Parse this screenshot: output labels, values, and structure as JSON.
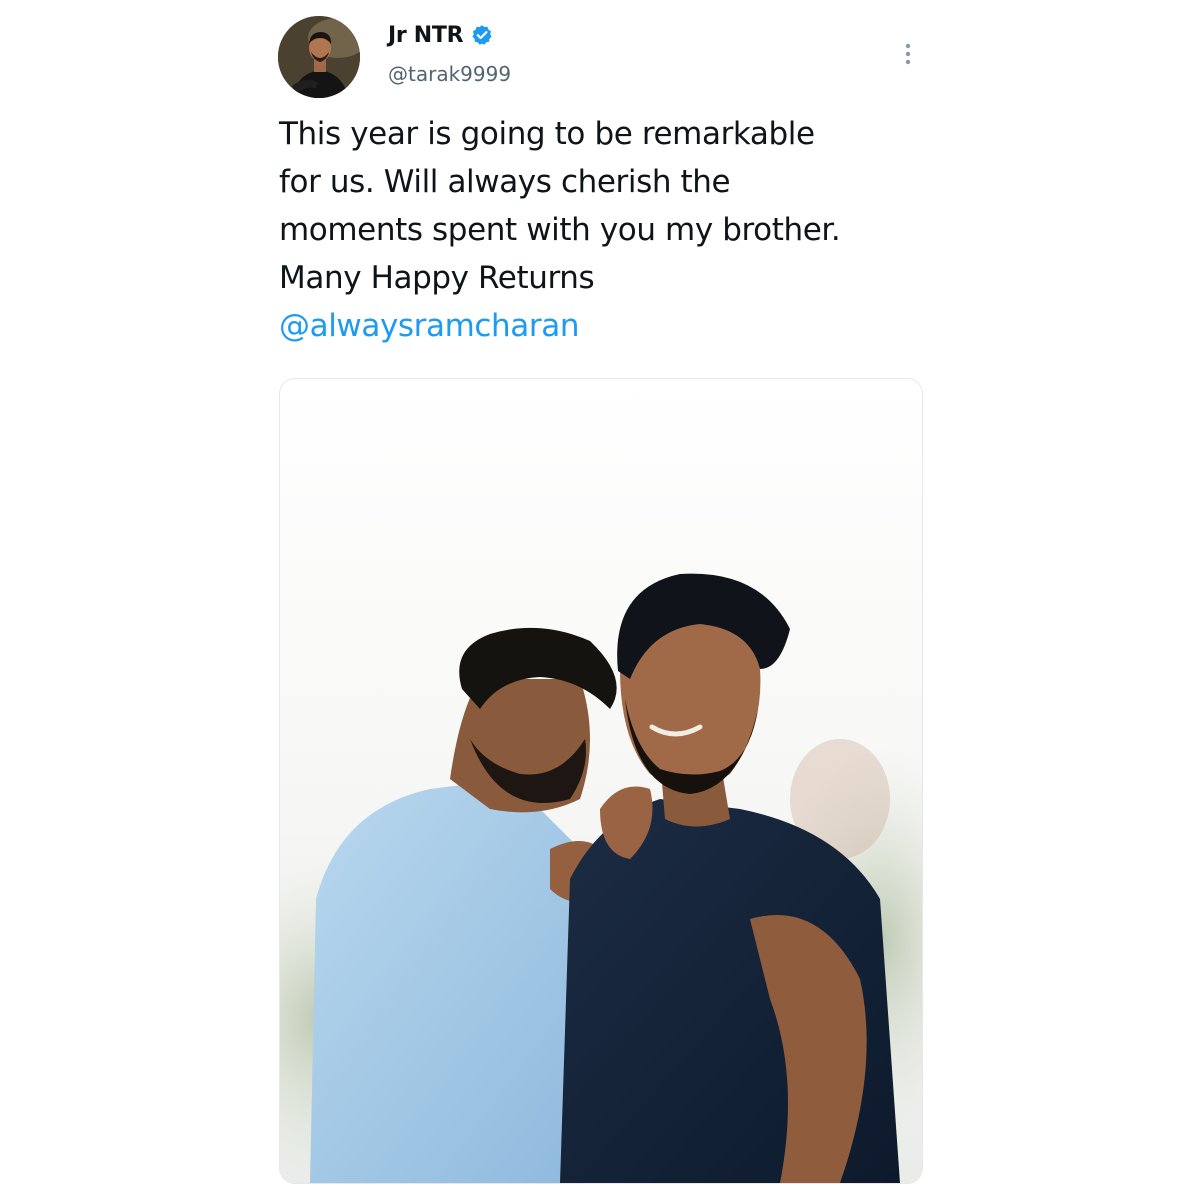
{
  "tweet": {
    "author": {
      "display_name": "Jr NTR",
      "handle": "@tarak9999",
      "verified": true,
      "avatar_icon": "profile-photo"
    },
    "text_lines": [
      "This year is going to be remarkable",
      "for us. Will always cherish the",
      "moments spent with you my brother.",
      "Many Happy Returns"
    ],
    "mention": "@alwaysramcharan",
    "more_icon": "vertical-ellipsis-icon",
    "media": {
      "type": "photo"
    }
  },
  "colors": {
    "text": "#0f1419",
    "secondary_text": "#536471",
    "accent": "#1d9bf0",
    "verified_badge": "#1d9bf0",
    "media_border": "#e4e8ec"
  }
}
